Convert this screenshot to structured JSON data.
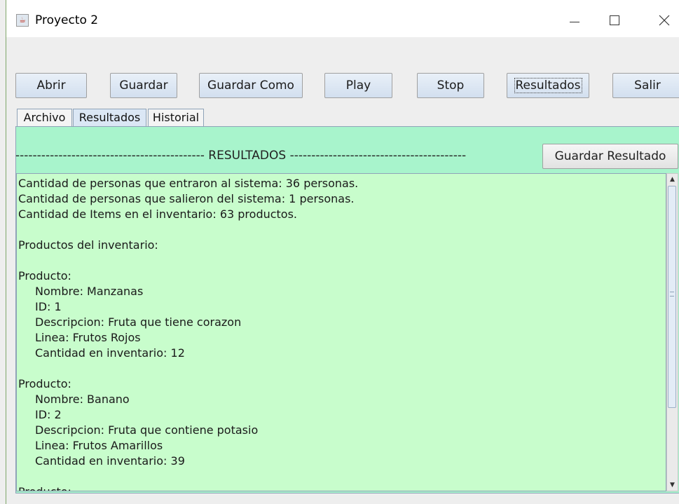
{
  "window": {
    "title": "Proyecto 2",
    "icon": "java-cup-icon"
  },
  "toolbar": {
    "abrir": "Abrir",
    "guardar": "Guardar",
    "guardar_como": "Guardar Como",
    "play": "Play",
    "stop": "Stop",
    "resultados": "Resultados",
    "salir": "Salir"
  },
  "tabs": [
    {
      "label": "Archivo"
    },
    {
      "label": "Resultados"
    },
    {
      "label": "Historial"
    }
  ],
  "active_tab": "Resultados",
  "results": {
    "header": "-------------------------------------------- RESULTADOS -----------------------------------------",
    "save_button": "Guardar Resultado",
    "lines": [
      "Cantidad de personas que entraron al sistema: 36 personas.",
      "Cantidad de personas que salieron del sistema: 1 personas.",
      "Cantidad de Items en el inventario: 63 productos.",
      "",
      "Productos del inventario:",
      "",
      "Producto:",
      "Nombre: Manzanas",
      "ID: 1",
      "Descripcion: Fruta que tiene corazon",
      "Linea: Frutos Rojos",
      "Cantidad en inventario: 12",
      "",
      "Producto:",
      "Nombre: Banano",
      "ID: 2",
      "Descripcion: Fruta que contiene potasio",
      "Linea: Frutos Amarillos",
      "Cantidad en inventario: 39",
      "",
      "Producto:"
    ]
  },
  "colors": {
    "panel_background": "#a8f4cc",
    "text_area_background": "#c8fdcc",
    "button_gradient_top": "#e9f0f8"
  }
}
